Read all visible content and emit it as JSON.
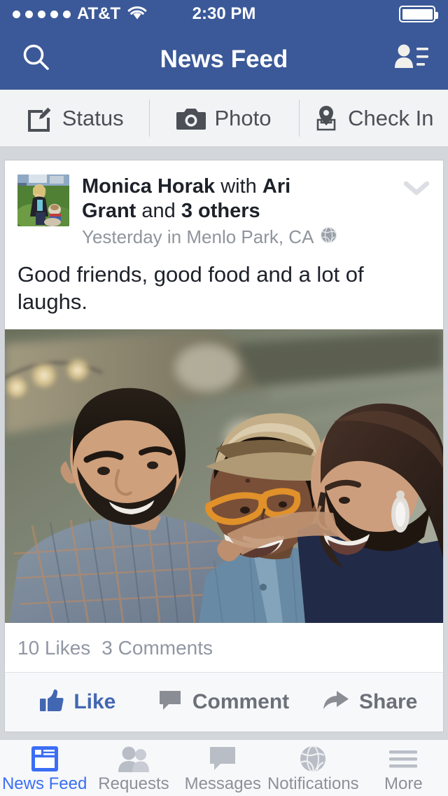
{
  "status_bar": {
    "signal_dots": 5,
    "carrier": "AT&T",
    "wifi_icon": "wifi-icon",
    "time": "2:30 PM",
    "battery_icon": "battery-full-icon",
    "battery_level": 100
  },
  "nav_bar": {
    "title": "News Feed",
    "search_icon": "search-icon",
    "friends_icon": "friend-requests-icon",
    "background_color": "#3b5998"
  },
  "composer": {
    "items": [
      {
        "label": "Status",
        "icon": "compose-status-icon"
      },
      {
        "label": "Photo",
        "icon": "camera-icon"
      },
      {
        "label": "Check In",
        "icon": "location-pin-icon"
      }
    ]
  },
  "post": {
    "avatar_icon": "author-avatar",
    "author": "Monica Horak",
    "connector_with": "with",
    "tagged_friend": "Ari Grant",
    "connector_and": "and",
    "others": "3 others",
    "byline_full": "Monica Horak with Ari Grant and 3 others",
    "timestamp": "Yesterday in Menlo Park, CA",
    "privacy_icon": "globe-icon",
    "menu_icon": "chevron-down-icon",
    "text": "Good friends, good food and a lot of laughs.",
    "photo_alt": "Three friends laughing together outdoors",
    "likes": "10 Likes",
    "comments": "3 Comments",
    "actions": [
      {
        "label": "Like",
        "icon": "thumbs-up-icon",
        "state": "liked"
      },
      {
        "label": "Comment",
        "icon": "comment-bubble-icon",
        "state": "default"
      },
      {
        "label": "Share",
        "icon": "share-arrow-icon",
        "state": "default"
      }
    ]
  },
  "tab_bar": {
    "items": [
      {
        "label": "News Feed",
        "icon": "news-feed-icon",
        "active": true
      },
      {
        "label": "Requests",
        "icon": "friend-requests-icon",
        "active": false
      },
      {
        "label": "Messages",
        "icon": "messages-icon",
        "active": false
      },
      {
        "label": "Notifications",
        "icon": "globe-notifications-icon",
        "active": false
      },
      {
        "label": "More",
        "icon": "hamburger-more-icon",
        "active": false
      }
    ]
  },
  "colors": {
    "brand_blue": "#3b5998",
    "link_blue": "#4267b2",
    "active_tab_blue": "#3b6ef5",
    "page_background": "#d3d6db",
    "card_background": "#ffffff",
    "muted_text": "#90949c"
  }
}
